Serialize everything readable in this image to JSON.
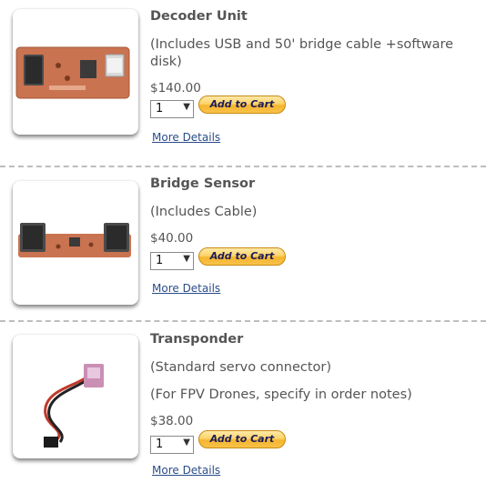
{
  "products": [
    {
      "title": "Decoder Unit",
      "desc": [
        "(Includes USB and 50' bridge cable +software",
        "disk)"
      ],
      "price": "$140.00",
      "qty": "1",
      "cart_label": "Add to Cart",
      "more_label": "More Details"
    },
    {
      "title": "Bridge Sensor",
      "desc": [
        "(Includes Cable)"
      ],
      "price": "$40.00",
      "qty": "1",
      "cart_label": "Add to Cart",
      "more_label": "More Details"
    },
    {
      "title": "Transponder",
      "desc": [
        "(Standard servo connector)",
        "(For FPV Drones, specify in order notes)"
      ],
      "price": "$38.00",
      "qty": "1",
      "cart_label": "Add to Cart",
      "more_label": "More Details"
    }
  ],
  "icons": {
    "dropdown": "chevron-down-icon"
  },
  "colors": {
    "cart_button": "#f7c24a",
    "link": "#2a4d8a",
    "separator": "#bdbdbd"
  }
}
